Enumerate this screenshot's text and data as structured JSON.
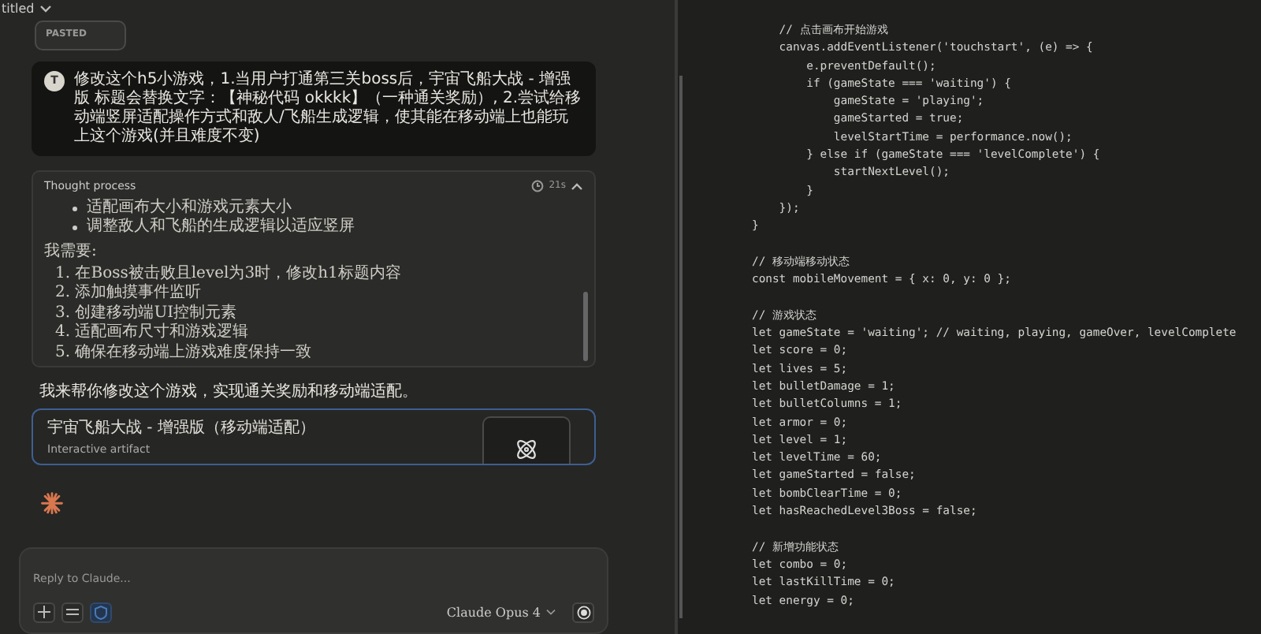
{
  "header": {
    "title": "titled"
  },
  "pasted_chip": {
    "label": "PASTED"
  },
  "user_message": {
    "avatar": "T",
    "text": "修改这个h5小游戏，1.当用户打通第三关boss后，宇宙飞船大战 - 增强版 标题会替换文字：【神秘代码 okkkk】（一种通关奖励）, 2.尝试给移动端竖屏适配操作方式和敌人/飞船生成逻辑，使其能在移动端上也能玩上这个游戏(并且难度不变)"
  },
  "thought": {
    "title": "Thought process",
    "duration": "21s",
    "expanded": true,
    "bullets": [
      "适配画布大小和游戏元素大小",
      "调整敌人和飞船的生成逻辑以适应竖屏"
    ],
    "heading": "我需要:",
    "steps": [
      "1. 在Boss被击败且level为3时，修改h1标题内容",
      "2. 添加触摸事件监听",
      "3. 创建移动端UI控制元素",
      "4. 适配画布尺寸和游戏逻辑",
      "5. 确保在移动端上游戏难度保持一致"
    ]
  },
  "assistant_text": "我来帮你修改这个游戏，实现通关奖励和移动端适配。",
  "artifact": {
    "title": "宇宙飞船大战 - 增强版（移动端适配）",
    "subtitle": "Interactive artifact"
  },
  "composer": {
    "placeholder": "Reply to Claude...",
    "model": "Claude Opus 4"
  },
  "code_blocks": [
    [
      "    // 点击画布开始游戏",
      "    canvas.addEventListener('touchstart', (e) => {",
      "        e.preventDefault();",
      "        if (gameState === 'waiting') {",
      "            gameState = 'playing';",
      "            gameStarted = true;",
      "            levelStartTime = performance.now();",
      "        } else if (gameState === 'levelComplete') {",
      "            startNextLevel();",
      "        }",
      "    });",
      "}"
    ],
    [
      "// 移动端移动状态",
      "const mobileMovement = { x: 0, y: 0 };"
    ],
    [
      "// 游戏状态",
      "let gameState = 'waiting'; // waiting, playing, gameOver, levelComplete",
      "let score = 0;",
      "let lives = 5;",
      "let bulletDamage = 1;",
      "let bulletColumns = 1;",
      "let armor = 0;",
      "let level = 1;",
      "let levelTime = 60;",
      "let gameStarted = false;",
      "let bombClearTime = 0;",
      "let hasReachedLevel3Boss = false;"
    ],
    [
      "// 新增功能状态",
      "let combo = 0;",
      "let lastKillTime = 0;",
      "let energy = 0;"
    ]
  ]
}
